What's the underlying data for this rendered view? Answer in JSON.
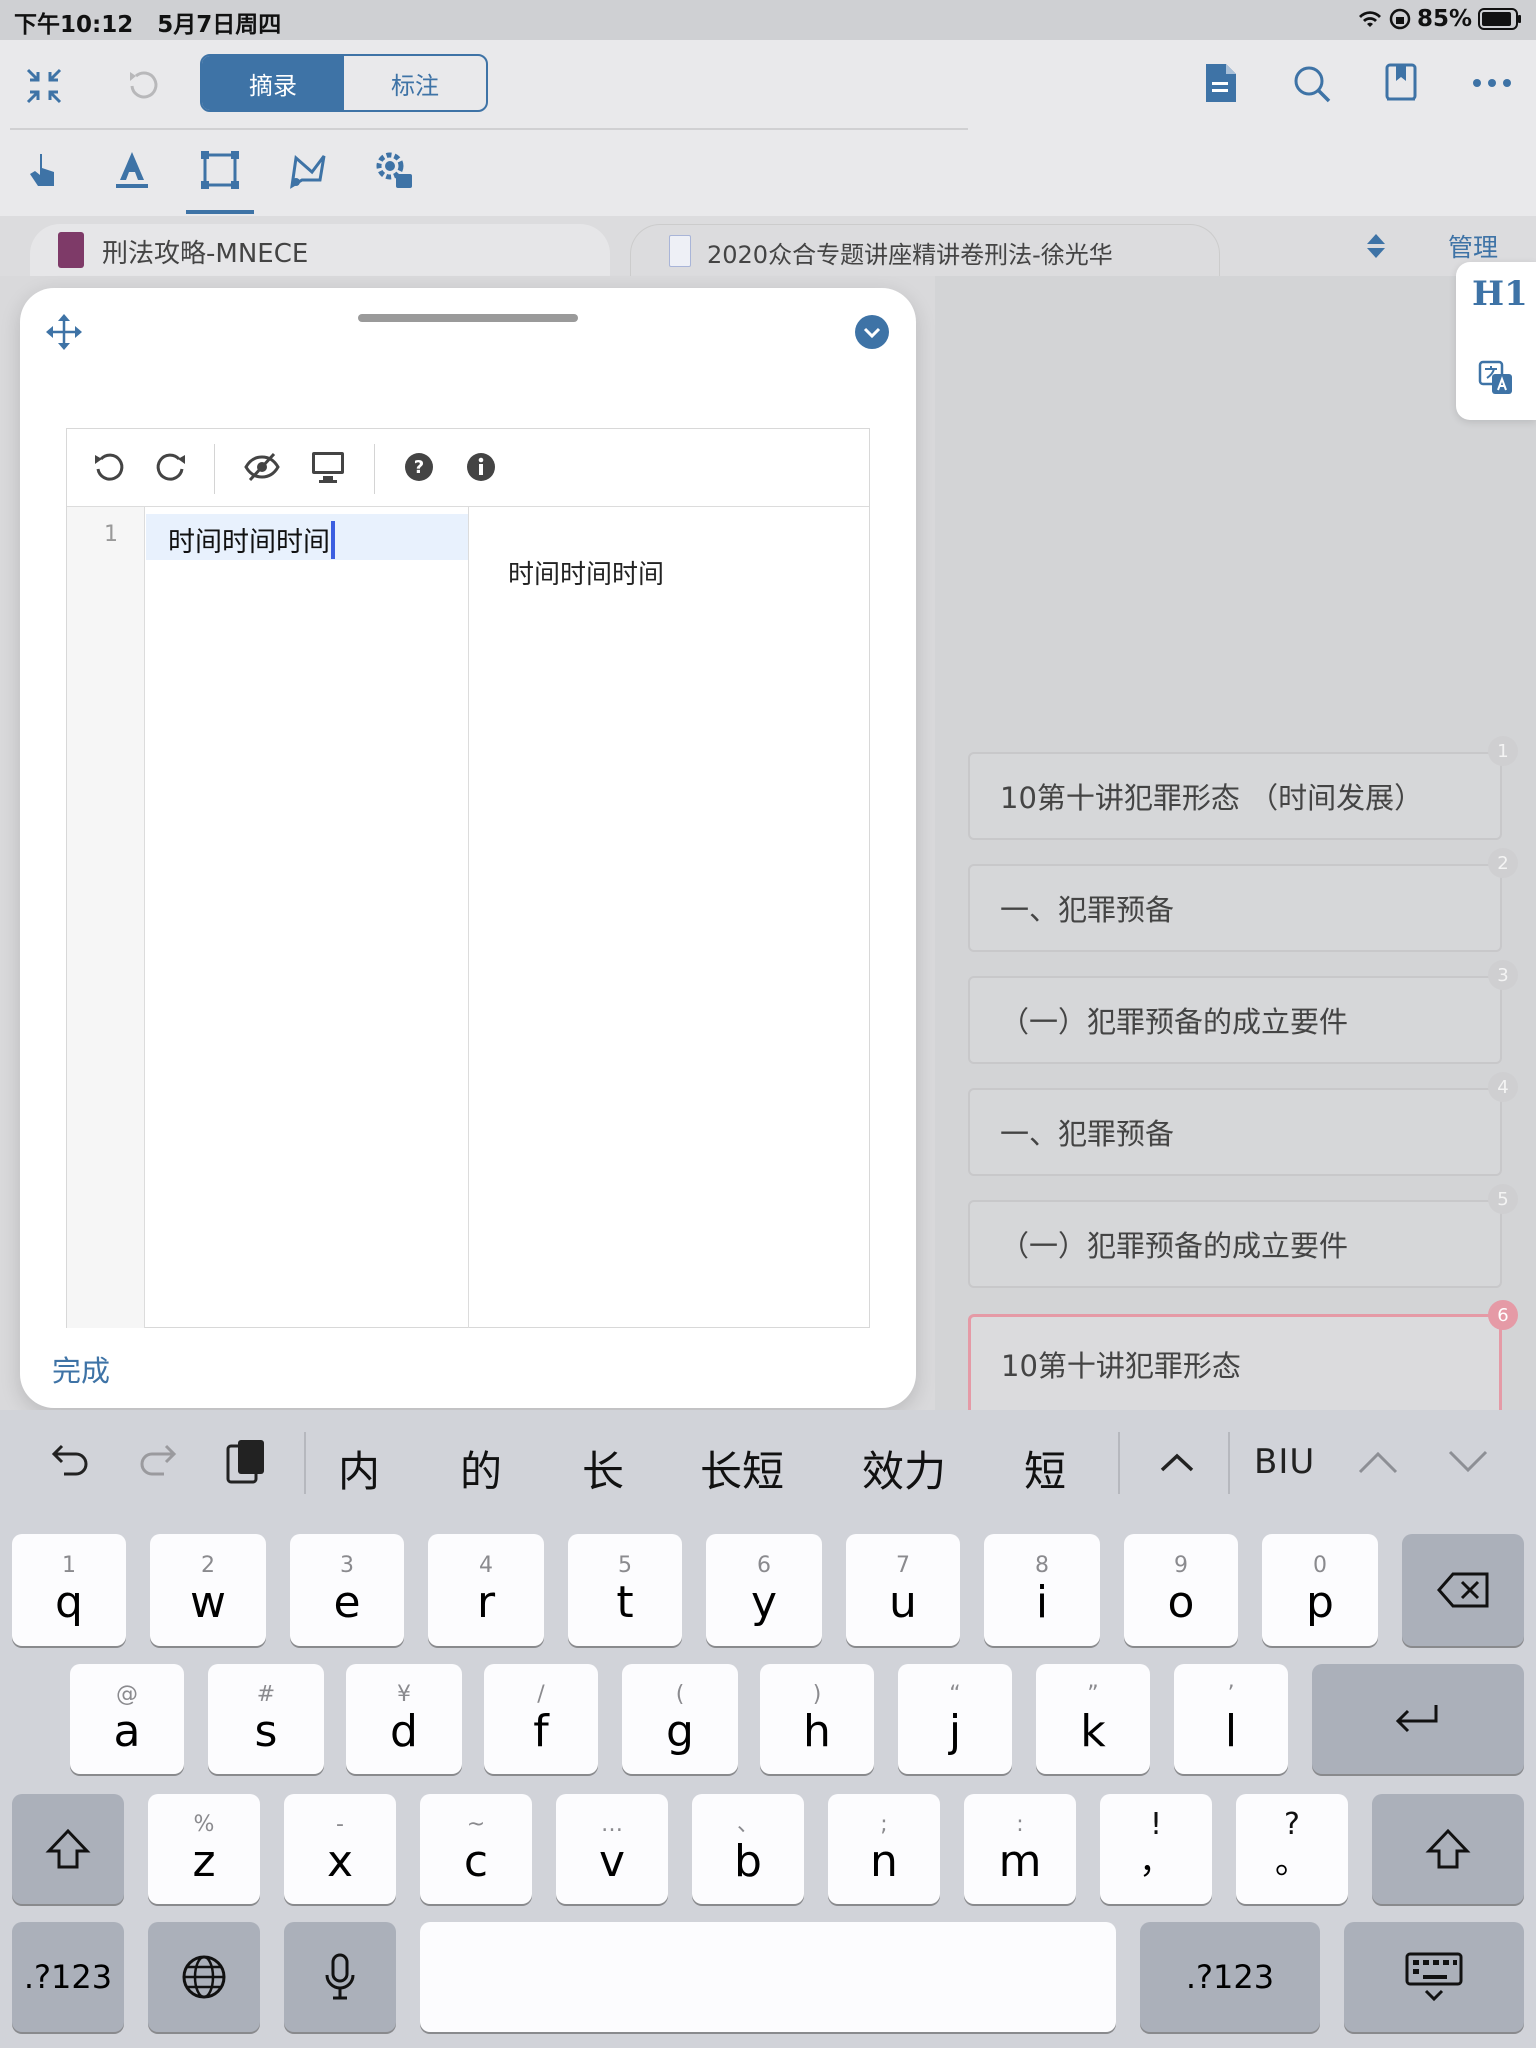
{
  "status_bar": {
    "time": "下午10:12",
    "date": "5月7日周四",
    "battery": "85%"
  },
  "toolbar": {
    "segment": [
      "摘录",
      "标注"
    ],
    "active_segment": 0
  },
  "tabs": {
    "tab1": "刑法攻略-MNECE",
    "tab2": "2020众合专题讲座精讲卷刑法-徐光华",
    "manage": "管理"
  },
  "float_panel": {
    "h1": "H1"
  },
  "outline": {
    "cards": [
      {
        "num": "1",
        "text": "10第十讲犯罪形态 （时间发展）"
      },
      {
        "num": "2",
        "text": "一、犯罪预备"
      },
      {
        "num": "3",
        "text": "（一）犯罪预备的成立要件"
      },
      {
        "num": "4",
        "text": "一、犯罪预备"
      },
      {
        "num": "5",
        "text": "（一）犯罪预备的成立要件"
      },
      {
        "num": "6",
        "text": "10第十讲犯罪形态"
      }
    ],
    "selected_index": 5
  },
  "editor": {
    "line_number": "1",
    "source_text": "时间时间时间",
    "preview_text": "时间时间时间",
    "done_label": "完成"
  },
  "keyboard": {
    "candidates": [
      "内",
      "的",
      "长",
      "长短",
      "效力",
      "短"
    ],
    "format_label": "BIU",
    "row1": [
      {
        "k": "q",
        "s": "1"
      },
      {
        "k": "w",
        "s": "2"
      },
      {
        "k": "e",
        "s": "3"
      },
      {
        "k": "r",
        "s": "4"
      },
      {
        "k": "t",
        "s": "5"
      },
      {
        "k": "y",
        "s": "6"
      },
      {
        "k": "u",
        "s": "7"
      },
      {
        "k": "i",
        "s": "8"
      },
      {
        "k": "o",
        "s": "9"
      },
      {
        "k": "p",
        "s": "0"
      }
    ],
    "row2": [
      {
        "k": "a",
        "s": "@"
      },
      {
        "k": "s",
        "s": "#"
      },
      {
        "k": "d",
        "s": "¥"
      },
      {
        "k": "f",
        "s": "/"
      },
      {
        "k": "g",
        "s": "("
      },
      {
        "k": "h",
        "s": ")"
      },
      {
        "k": "j",
        "s": "“"
      },
      {
        "k": "k",
        "s": "”"
      },
      {
        "k": "l",
        "s": "’"
      }
    ],
    "row3": [
      {
        "k": "z",
        "s": "%"
      },
      {
        "k": "x",
        "s": "-"
      },
      {
        "k": "c",
        "s": "~"
      },
      {
        "k": "v",
        "s": "…"
      },
      {
        "k": "b",
        "s": "、"
      },
      {
        "k": "n",
        "s": ";"
      },
      {
        "k": "m",
        "s": ":"
      },
      {
        "k": "，",
        "s": "!"
      },
      {
        "k": "。",
        "s": "?"
      }
    ],
    "num_label": ".?123"
  },
  "colors": {
    "accent": "#3e73a6",
    "selected": "#e59aa6",
    "keyboard_bg": "#d1d3d9"
  }
}
